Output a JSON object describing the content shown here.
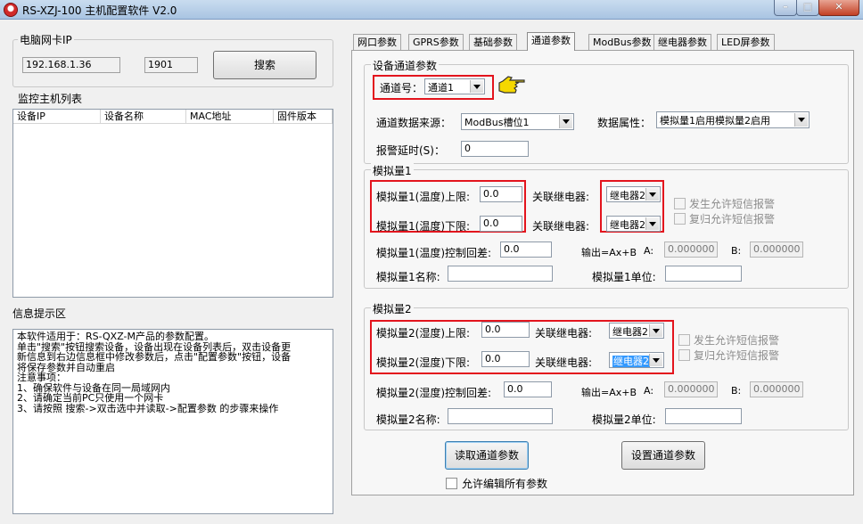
{
  "window": {
    "title": "RS-XZJ-100 主机配置软件 V2.0",
    "controls": [
      "minimize",
      "maximize",
      "close"
    ]
  },
  "nic": {
    "group_label": "电脑网卡IP",
    "ip": "192.168.1.36",
    "port": "1901",
    "search_button": "搜索"
  },
  "host_list": {
    "label": "监控主机列表",
    "columns": [
      "设备IP",
      "设备名称",
      "MAC地址",
      "固件版本"
    ]
  },
  "info": {
    "label": "信息提示区",
    "lines": [
      "    本软件适用于：RS-QXZ-M产品的参数配置。",
      "单击\"搜索\"按钮搜索设备，设备出现在设备列表后，双击设备更",
      "新信息到右边信息框中修改参数后，点击\"配置参数\"按钮，设备",
      "将保存参数并自动重启",
      "注意事项：",
      "1、确保软件与设备在同一局域网内",
      "2、请确定当前PC只使用一个网卡",
      "3、请按照 搜索->双击选中并读取->配置参数 的步骤来操作"
    ]
  },
  "tabs": [
    {
      "label": "网口参数"
    },
    {
      "label": "GPRS参数"
    },
    {
      "label": "基础参数"
    },
    {
      "label": "通道参数"
    },
    {
      "label": "ModBus参数"
    },
    {
      "label": "继电器参数"
    },
    {
      "label": "LED屏参数"
    }
  ],
  "channel": {
    "group_label": "设备通道参数",
    "channel_label": "通道号：",
    "channel_value": "通道1",
    "source_label": "通道数据来源：",
    "source_value": "ModBus槽位1",
    "attr_label": "数据属性：",
    "attr_value": "模拟量1启用模拟量2启用",
    "delay_label": "报警延时(S)：",
    "delay_value": "0"
  },
  "analog1": {
    "group_label": "模拟量1",
    "upper_label": "模拟量1(温度)上限:",
    "upper_value": "0.0",
    "lower_label": "模拟量1(温度)下限:",
    "lower_value": "0.0",
    "relay_label": "关联继电器:",
    "relay_upper": "继电器2",
    "relay_lower": "继电器2",
    "sms_alarm": "发生允许短信报警",
    "sms_reset": "复归允许短信报警",
    "hyst_label": "模拟量1(温度)控制回差:",
    "hyst_value": "0.0",
    "formula_label": "输出=Ax+B",
    "a_label": "A:",
    "a_value": "0.000000",
    "b_label": "B:",
    "b_value": "0.000000",
    "name_label": "模拟量1名称:",
    "unit_label": "模拟量1单位:"
  },
  "analog2": {
    "group_label": "模拟量2",
    "upper_label": "模拟量2(湿度)上限:",
    "upper_value": "0.0",
    "lower_label": "模拟量2(湿度)下限:",
    "lower_value": "0.0",
    "relay_label": "关联继电器:",
    "relay_upper": "继电器2",
    "relay_lower": "继电器2",
    "sms_alarm": "发生允许短信报警",
    "sms_reset": "复归允许短信报警",
    "hyst_label": "模拟量2(湿度)控制回差:",
    "hyst_value": "0.0",
    "formula_label": "输出=Ax+B",
    "a_label": "A:",
    "a_value": "0.000000",
    "b_label": "B:",
    "b_value": "0.000000",
    "name_label": "模拟量2名称:",
    "unit_label": "模拟量2单位:"
  },
  "actions": {
    "read_button": "读取通道参数",
    "set_button": "设置通道参数",
    "allow_edit_all": "允许编辑所有参数"
  },
  "colors": {
    "highlight": "#e3141d",
    "selection": "#3399ff",
    "pointer": "#f5d800"
  }
}
